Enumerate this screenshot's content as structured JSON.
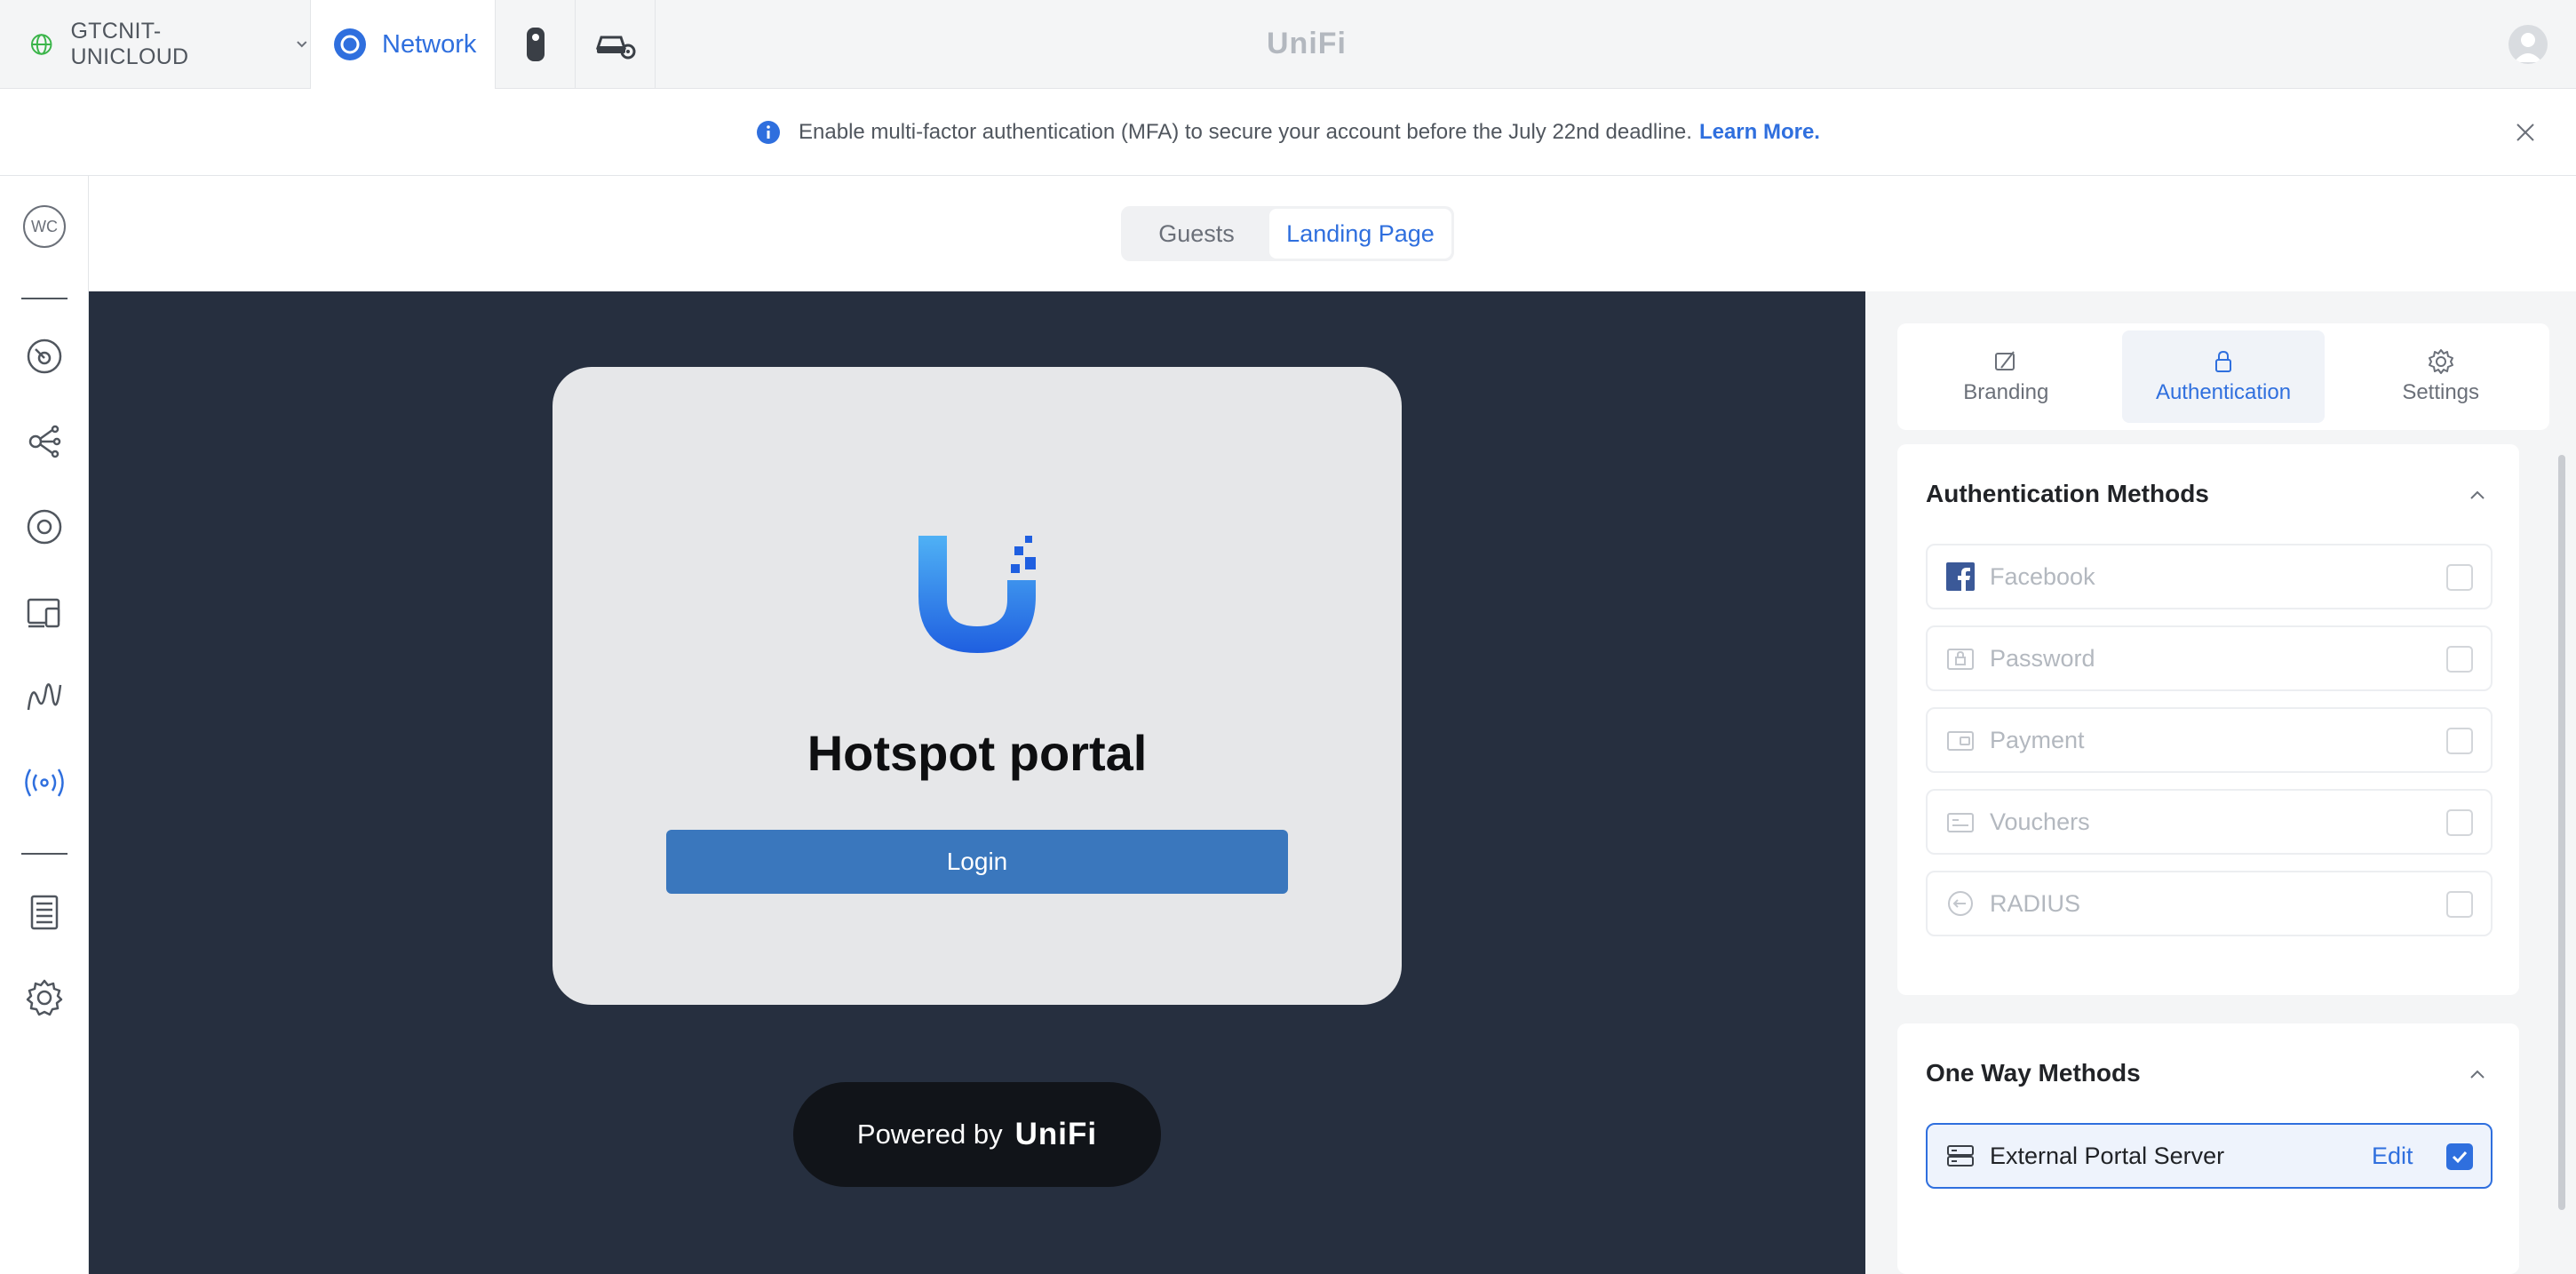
{
  "topbar": {
    "site_name": "GTCNIT-UNICLOUD",
    "app_tab_label": "Network",
    "brand": "UniFi",
    "icons": [
      "globe-icon",
      "chevron-down-icon",
      "network-app-icon",
      "protect-camera-icon",
      "vehicle-gear-icon",
      "user-avatar-icon"
    ]
  },
  "banner": {
    "message": "Enable multi-factor authentication (MFA) to secure your account before the July 22nd deadline.",
    "link": "Learn More."
  },
  "leftnav": {
    "initials": "WC",
    "items": [
      "dashboard-icon",
      "topology-icon",
      "devices-icon",
      "clients-icon",
      "insights-icon",
      "hotspot-icon",
      "logs-icon",
      "settings-icon"
    ]
  },
  "segmented": {
    "tabs": [
      {
        "label": "Guests",
        "active": false
      },
      {
        "label": "Landing Page",
        "active": true
      }
    ]
  },
  "preview": {
    "title": "Hotspot portal",
    "login_label": "Login",
    "powered_by": "Powered by",
    "powered_logo": "UniFi"
  },
  "panel": {
    "tabs": [
      {
        "label": "Branding",
        "icon": "branding-icon",
        "active": false
      },
      {
        "label": "Authentication",
        "icon": "lock-icon",
        "active": true
      },
      {
        "label": "Settings",
        "icon": "gear-icon",
        "active": false
      }
    ],
    "auth_methods": {
      "heading": "Authentication Methods",
      "items": [
        {
          "label": "Facebook",
          "icon": "facebook-icon",
          "checked": false
        },
        {
          "label": "Password",
          "icon": "password-icon",
          "checked": false
        },
        {
          "label": "Payment",
          "icon": "payment-icon",
          "checked": false
        },
        {
          "label": "Vouchers",
          "icon": "voucher-icon",
          "checked": false
        },
        {
          "label": "RADIUS",
          "icon": "radius-icon",
          "checked": false
        }
      ]
    },
    "one_way": {
      "heading": "One Way Methods",
      "item_label": "External Portal Server",
      "edit_label": "Edit",
      "checked": true
    }
  },
  "colors": {
    "accent": "#2f6fde",
    "preview_bg": "#262f3f",
    "login_button": "#3a77bd"
  }
}
